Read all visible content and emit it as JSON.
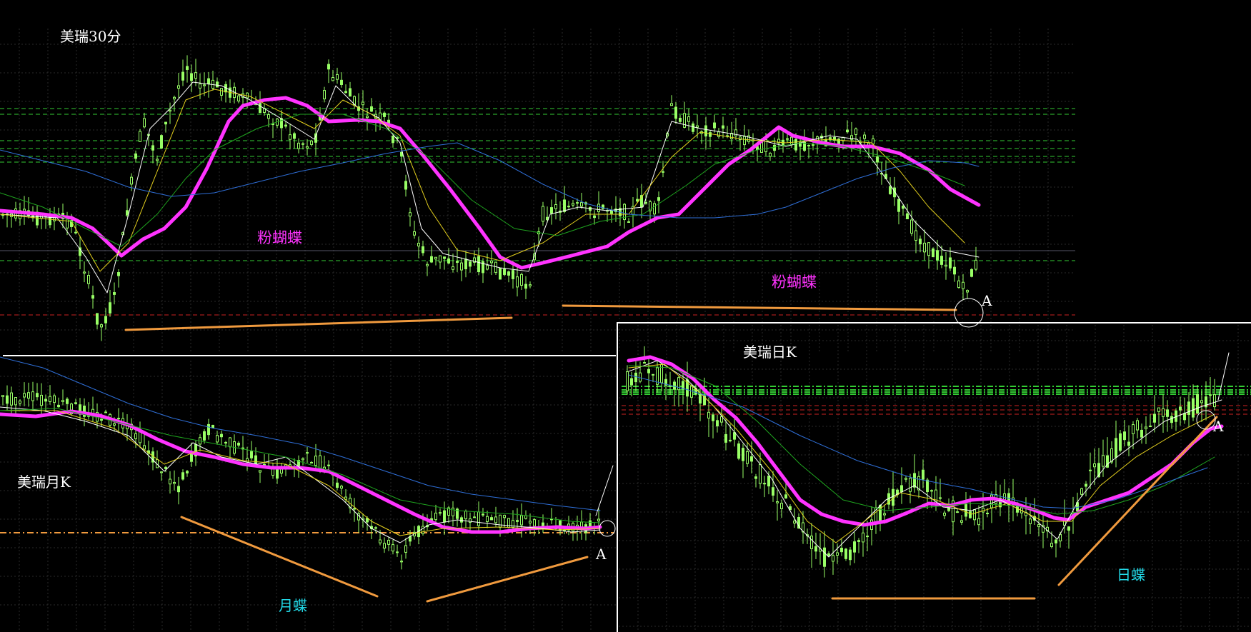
{
  "colors": {
    "background": "#000000",
    "grid": "#2a2a2a",
    "candle": "#99ff66",
    "ma_pink": "#ff33ff",
    "ma_white": "#ffffff",
    "ma_yellow": "#e6d21e",
    "ma_green": "#1fa51f",
    "ma_blue": "#2f6fd8",
    "level_green": "#33cc33",
    "level_red": "#cc2222",
    "trend": "#f09a3e",
    "pink_text": "#ff33ff",
    "cyan_text": "#22d8e6"
  },
  "chart_data": [
    {
      "type": "candlestick",
      "title": "美瑞30分",
      "annotations": [
        "粉蝴蝶",
        "粉蝴蝶",
        "A"
      ],
      "indicators": [
        "pink thick MA",
        "white MA",
        "yellow MA",
        "green MA",
        "blue MA"
      ],
      "grid": true
    },
    {
      "type": "candlestick",
      "title": "美瑞月K",
      "annotations": [
        "月蝶",
        "A"
      ],
      "indicators": [
        "pink thick MA",
        "white MA",
        "yellow MA",
        "green MA",
        "blue MA"
      ],
      "grid": true
    },
    {
      "type": "candlestick",
      "title": "美瑞日K",
      "annotations": [
        "日蝶",
        "A"
      ],
      "indicators": [
        "pink thick MA",
        "white MA",
        "yellow MA",
        "green MA",
        "blue MA"
      ],
      "grid": true
    }
  ],
  "texts": {
    "top_title": "美瑞30分",
    "top_note1": "粉蝴蝶",
    "top_note2": "粉蝴蝶",
    "top_point": "A",
    "month_title": "美瑞月K",
    "month_note": "月蝶",
    "month_point": "A",
    "day_title": "美瑞日K",
    "day_note": "日蝶",
    "day_point": "A"
  }
}
